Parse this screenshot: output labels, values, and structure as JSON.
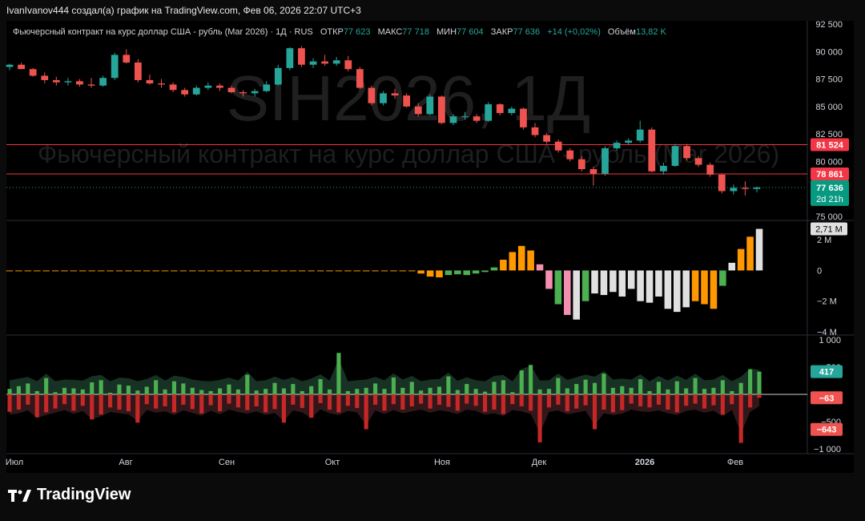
{
  "header": {
    "attribution": "IvanIvanov444 создал(а) график на TradingView.com, Фев 06, 2026 22:07 UTC+3"
  },
  "legend": {
    "name": "Фьючерсный контракт на курс доллар США - рубль (Mar 2026) · 1Д · RUS",
    "open_label": "ОТКР",
    "open_value": "77 623",
    "high_label": "МАКС",
    "high_value": "77 718",
    "low_label": "МИН",
    "low_value": "77 604",
    "close_label": "ЗАКР",
    "close_value": "77 636",
    "change": "+14 (+0,02%)",
    "volume_label": "Объём",
    "volume_value": "13,82 K"
  },
  "watermark": {
    "ticker": "SIH2026, 1Д",
    "description": "Фьючерсный контракт на курс доллар США - рубль (Mar 2026)"
  },
  "branding": {
    "logo_text": "TradingView"
  },
  "colors": {
    "up": "#26a69a",
    "down": "#ef5350",
    "light_up": "#4caf50",
    "orange": "#ff9800",
    "pink": "#f48fb1",
    "white": "#e0e0e0",
    "level_line": "#f23645"
  },
  "chart_data": [
    {
      "type": "candlestick",
      "title": "Фьючерсный контракт на курс доллар США - рубль (Mar 2026)",
      "ylim": [
        75000,
        92500
      ],
      "y_ticks": [
        "92 500",
        "90 000",
        "87 500",
        "85 000",
        "82 500",
        "80 000",
        "75 000"
      ],
      "x_ticks": [
        "Июл",
        "Авг",
        "Сен",
        "Окт",
        "Ноя",
        "Дек",
        "2026",
        "Фев"
      ],
      "levels": [
        {
          "value": 81524,
          "label": "81 524"
        },
        {
          "value": 78861,
          "label": "78 861"
        }
      ],
      "last_price": {
        "value": 77636,
        "label": "77 636",
        "countdown": "2d 21h"
      },
      "close_trend": [
        88800,
        88300,
        87300,
        87200,
        87100,
        86900,
        87600,
        89700,
        87400,
        87000,
        86500,
        86100,
        86700,
        86700,
        86300,
        86200,
        87000,
        88500,
        90300,
        88800,
        88900,
        89200,
        88400,
        86700,
        85300,
        86200,
        86000,
        85000,
        84300,
        85900,
        83500,
        84100,
        84100,
        83700,
        85200,
        84400,
        84800,
        83100,
        82400,
        81800,
        81000,
        80200,
        79300,
        78900,
        81200,
        81700,
        81900,
        79100,
        79600,
        81400,
        80300,
        79700,
        78800,
        77300,
        77600,
        77500,
        77636
      ],
      "candles": [
        {
          "o": 88600,
          "h": 88900,
          "l": 88300,
          "c": 88800
        },
        {
          "o": 88800,
          "h": 89000,
          "l": 88400,
          "c": 88400
        },
        {
          "o": 88400,
          "h": 88500,
          "l": 87700,
          "c": 87800
        },
        {
          "o": 87800,
          "h": 88100,
          "l": 87100,
          "c": 87400
        },
        {
          "o": 87400,
          "h": 87700,
          "l": 86900,
          "c": 87200
        },
        {
          "o": 87200,
          "h": 87600,
          "l": 86900,
          "c": 87300
        },
        {
          "o": 87300,
          "h": 87500,
          "l": 86800,
          "c": 87000
        },
        {
          "o": 87000,
          "h": 87600,
          "l": 86700,
          "c": 86900
        },
        {
          "o": 86900,
          "h": 87800,
          "l": 86800,
          "c": 87600
        },
        {
          "o": 87600,
          "h": 89900,
          "l": 87400,
          "c": 89700
        },
        {
          "o": 89700,
          "h": 90200,
          "l": 88900,
          "c": 89000
        },
        {
          "o": 89000,
          "h": 89300,
          "l": 87200,
          "c": 87400
        },
        {
          "o": 87400,
          "h": 87900,
          "l": 87000,
          "c": 87100
        },
        {
          "o": 87100,
          "h": 87500,
          "l": 86700,
          "c": 87000
        },
        {
          "o": 87000,
          "h": 87200,
          "l": 86300,
          "c": 86500
        },
        {
          "o": 86500,
          "h": 86700,
          "l": 85900,
          "c": 86100
        },
        {
          "o": 86100,
          "h": 86900,
          "l": 86000,
          "c": 86700
        },
        {
          "o": 86700,
          "h": 87200,
          "l": 86500,
          "c": 86900
        },
        {
          "o": 86900,
          "h": 87100,
          "l": 86400,
          "c": 86700
        },
        {
          "o": 86700,
          "h": 86900,
          "l": 86200,
          "c": 86300
        },
        {
          "o": 86300,
          "h": 86500,
          "l": 85900,
          "c": 86200
        },
        {
          "o": 86200,
          "h": 86600,
          "l": 85900,
          "c": 86400
        },
        {
          "o": 86400,
          "h": 87300,
          "l": 86300,
          "c": 87000
        },
        {
          "o": 87000,
          "h": 88800,
          "l": 86900,
          "c": 88500
        },
        {
          "o": 88500,
          "h": 90400,
          "l": 88300,
          "c": 90300
        },
        {
          "o": 90300,
          "h": 90500,
          "l": 88600,
          "c": 88800
        },
        {
          "o": 88800,
          "h": 89400,
          "l": 88500,
          "c": 89100
        },
        {
          "o": 89100,
          "h": 89700,
          "l": 88700,
          "c": 88900
        },
        {
          "o": 88900,
          "h": 89500,
          "l": 88700,
          "c": 89200
        },
        {
          "o": 89200,
          "h": 89600,
          "l": 88200,
          "c": 88400
        },
        {
          "o": 88400,
          "h": 88600,
          "l": 86600,
          "c": 86700
        },
        {
          "o": 86700,
          "h": 86900,
          "l": 85100,
          "c": 85300
        },
        {
          "o": 85300,
          "h": 86400,
          "l": 85100,
          "c": 86200
        },
        {
          "o": 86200,
          "h": 86600,
          "l": 85700,
          "c": 86000
        },
        {
          "o": 86000,
          "h": 86200,
          "l": 84900,
          "c": 85000
        },
        {
          "o": 85000,
          "h": 85300,
          "l": 84100,
          "c": 84300
        },
        {
          "o": 84300,
          "h": 86100,
          "l": 84200,
          "c": 85900
        },
        {
          "o": 85900,
          "h": 86000,
          "l": 83400,
          "c": 83500
        },
        {
          "o": 83500,
          "h": 84300,
          "l": 83300,
          "c": 84100
        },
        {
          "o": 84100,
          "h": 84500,
          "l": 83800,
          "c": 84100
        },
        {
          "o": 84100,
          "h": 84300,
          "l": 83500,
          "c": 83700
        },
        {
          "o": 83700,
          "h": 85400,
          "l": 83600,
          "c": 85200
        },
        {
          "o": 85200,
          "h": 85300,
          "l": 84200,
          "c": 84400
        },
        {
          "o": 84400,
          "h": 85000,
          "l": 84200,
          "c": 84800
        },
        {
          "o": 84800,
          "h": 84900,
          "l": 82900,
          "c": 83100
        },
        {
          "o": 83100,
          "h": 83500,
          "l": 82200,
          "c": 82400
        },
        {
          "o": 82400,
          "h": 82600,
          "l": 81600,
          "c": 81800
        },
        {
          "o": 81800,
          "h": 82000,
          "l": 80800,
          "c": 81000
        },
        {
          "o": 81000,
          "h": 81200,
          "l": 80000,
          "c": 80200
        },
        {
          "o": 80200,
          "h": 80500,
          "l": 79100,
          "c": 79300
        },
        {
          "o": 79300,
          "h": 79500,
          "l": 77800,
          "c": 78900
        },
        {
          "o": 78900,
          "h": 81400,
          "l": 78700,
          "c": 81200
        },
        {
          "o": 81200,
          "h": 81900,
          "l": 81000,
          "c": 81700
        },
        {
          "o": 81700,
          "h": 82100,
          "l": 81500,
          "c": 81900
        },
        {
          "o": 81900,
          "h": 83700,
          "l": 81700,
          "c": 82900
        },
        {
          "o": 82900,
          "h": 83100,
          "l": 79000,
          "c": 79100
        },
        {
          "o": 79100,
          "h": 79900,
          "l": 78800,
          "c": 79600
        },
        {
          "o": 79600,
          "h": 81600,
          "l": 79500,
          "c": 81400
        },
        {
          "o": 81400,
          "h": 81600,
          "l": 80100,
          "c": 80300
        },
        {
          "o": 80300,
          "h": 80500,
          "l": 79500,
          "c": 79700
        },
        {
          "o": 79700,
          "h": 79900,
          "l": 78600,
          "c": 78800
        },
        {
          "o": 78800,
          "h": 78900,
          "l": 77100,
          "c": 77300
        },
        {
          "o": 77300,
          "h": 77900,
          "l": 77000,
          "c": 77600
        },
        {
          "o": 77600,
          "h": 78200,
          "l": 76900,
          "c": 77500
        },
        {
          "o": 77500,
          "h": 77718,
          "l": 77200,
          "c": 77636
        }
      ]
    },
    {
      "type": "bar",
      "title": "",
      "ylim": [
        -4000000,
        3000000
      ],
      "y_ticks": [
        "2 M",
        "0",
        "−2 M",
        "−4 M"
      ],
      "last_label": "2,71 M",
      "values": [
        0,
        0,
        0,
        0,
        0,
        0,
        0,
        0,
        0,
        0,
        0,
        0,
        0,
        0,
        0,
        0,
        0,
        0,
        0,
        0,
        0,
        0,
        0,
        0,
        0,
        0,
        0,
        0,
        0,
        0,
        0,
        0,
        0,
        0,
        0,
        0,
        0,
        0,
        0,
        0,
        0,
        0,
        0,
        0,
        -50000,
        -200000,
        -400000,
        -450000,
        -300000,
        -250000,
        -300000,
        -200000,
        -100000,
        200000,
        700000,
        1200000,
        1600000,
        1300000,
        400000,
        -1200000,
        -2200000,
        -2900000,
        -3200000,
        -2000000,
        -1500000,
        -1600000,
        -1400000,
        -1700000,
        -1200000,
        -2000000,
        -2100000,
        -1700000,
        -2500000,
        -2700000,
        -2400000,
        -2000000,
        -2200000,
        -2500000,
        -1000000,
        500000,
        1400000,
        2200000,
        2710000
      ],
      "bar_colors": [
        "orange",
        "orange",
        "orange",
        "orange",
        "orange",
        "orange",
        "orange",
        "orange",
        "orange",
        "orange",
        "orange",
        "orange",
        "orange",
        "orange",
        "orange",
        "orange",
        "orange",
        "orange",
        "orange",
        "orange",
        "orange",
        "orange",
        "orange",
        "orange",
        "orange",
        "orange",
        "orange",
        "orange",
        "orange",
        "orange",
        "orange",
        "orange",
        "orange",
        "orange",
        "orange",
        "orange",
        "orange",
        "orange",
        "orange",
        "orange",
        "orange",
        "orange",
        "orange",
        "orange",
        "orange",
        "orange",
        "orange",
        "orange",
        "light_up",
        "light_up",
        "light_up",
        "light_up",
        "light_up",
        "light_up",
        "orange",
        "orange",
        "orange",
        "orange",
        "pink",
        "pink",
        "light_up",
        "pink",
        "white",
        "light_up",
        "white",
        "white",
        "white",
        "white",
        "white",
        "white",
        "white",
        "white",
        "white",
        "white",
        "white",
        "orange",
        "orange",
        "orange",
        "light_up",
        "white",
        "orange",
        "orange",
        "white"
      ]
    },
    {
      "type": "bar",
      "title": "",
      "ylim": [
        -1000,
        1000
      ],
      "y_ticks": [
        "1 000",
        "500",
        "0",
        "−500",
        "−1 000"
      ],
      "series": [
        {
          "name": "",
          "values": [
            100,
            150,
            200,
            60,
            300,
            40,
            120,
            110,
            90,
            220,
            260,
            30,
            180,
            160,
            70,
            140,
            260,
            90,
            240,
            200,
            120,
            80,
            60,
            110,
            180,
            90,
            360,
            70,
            100,
            210,
            110,
            190,
            60,
            150,
            280,
            90,
            760,
            60,
            100,
            120,
            200,
            100,
            310,
            120,
            230,
            70,
            120,
            140,
            330,
            80,
            190,
            100,
            50,
            230,
            260,
            40,
            440,
            540,
            90,
            100,
            300,
            110,
            190,
            270,
            210,
            380,
            120,
            150,
            120,
            280,
            60,
            230,
            90,
            240,
            110,
            300,
            100,
            120,
            260,
            60,
            210,
            460,
            417
          ]
        },
        {
          "name": "",
          "values": [
            -320,
            -280,
            -190,
            -420,
            -330,
            -260,
            -180,
            -300,
            -210,
            -460,
            -370,
            -240,
            -280,
            -310,
            -520,
            -180,
            -260,
            -220,
            -330,
            -190,
            -270,
            -350,
            -200,
            -310,
            -170,
            -240,
            -290,
            -220,
            -330,
            -270,
            -520,
            -190,
            -250,
            -430,
            -160,
            -280,
            -330,
            -210,
            -250,
            -640,
            -190,
            -300,
            -180,
            -280,
            -220,
            -170,
            -260,
            -190,
            -230,
            -300,
            -170,
            -210,
            -320,
            -280,
            -360,
            -180,
            -220,
            -300,
            -880,
            -240,
            -190,
            -310,
            -260,
            -200,
            -640,
            -280,
            -330,
            -290,
            -170,
            -220,
            -240,
            -190,
            -280,
            -330,
            -210,
            -170,
            -260,
            -200,
            -370,
            -180,
            -890,
            -240,
            -63
          ]
        }
      ],
      "last_labels": {
        "buy": "417",
        "sell": "−63",
        "sell_avg": "−643"
      }
    }
  ]
}
